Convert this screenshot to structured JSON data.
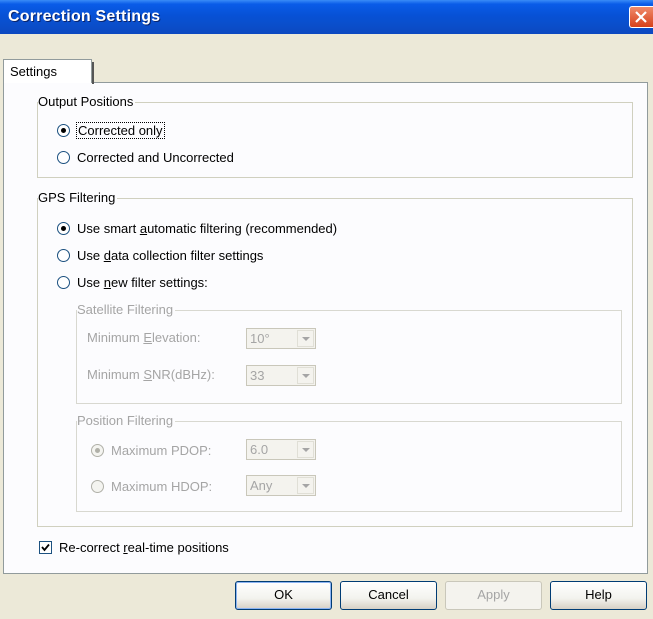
{
  "window": {
    "title": "Correction Settings"
  },
  "tabs": [
    {
      "label": "Settings"
    }
  ],
  "output_positions": {
    "label": "Output Positions",
    "options": [
      {
        "label": "Corrected only",
        "checked": true
      },
      {
        "label": "Corrected and Uncorrected",
        "checked": false
      }
    ]
  },
  "gps_filtering": {
    "label": "GPS Filtering",
    "option_smart": {
      "pre": "Use smart ",
      "key": "a",
      "post": "utomatic filtering (recommended)"
    },
    "option_collection": {
      "pre": "Use ",
      "key": "d",
      "post": "ata collection filter settings"
    },
    "option_new": {
      "pre": "Use ",
      "key": "n",
      "post": "ew filter settings:"
    },
    "selected": "smart"
  },
  "satellite_filtering": {
    "label": "Satellite Filtering",
    "min_elevation": {
      "pre": "Minimum ",
      "key": "E",
      "post": "levation:",
      "value": "10°"
    },
    "min_snr": {
      "pre": "Minimum ",
      "key": "S",
      "post": "NR(dBHz):",
      "value": "33"
    }
  },
  "position_filtering": {
    "label": "Position Filtering",
    "max_pdop": {
      "label": "Maximum PDOP:",
      "value": "6.0",
      "checked": true
    },
    "max_hdop": {
      "label": "Maximum HDOP:",
      "value": "Any",
      "checked": false
    }
  },
  "recorrect": {
    "pre": "Re-correct ",
    "key": "r",
    "post": "eal-time positions",
    "checked": true
  },
  "buttons": {
    "ok": "OK",
    "cancel": "Cancel",
    "apply": "Apply",
    "help": "Help"
  },
  "colors": {
    "title_bar": "#0a5ce8",
    "dialog_bg": "#ece9d8",
    "disabled_text": "#a5a5a5"
  },
  "icons": {
    "close": "close-icon",
    "dropdown": "chevron-down-icon",
    "check": "checkmark-icon"
  }
}
